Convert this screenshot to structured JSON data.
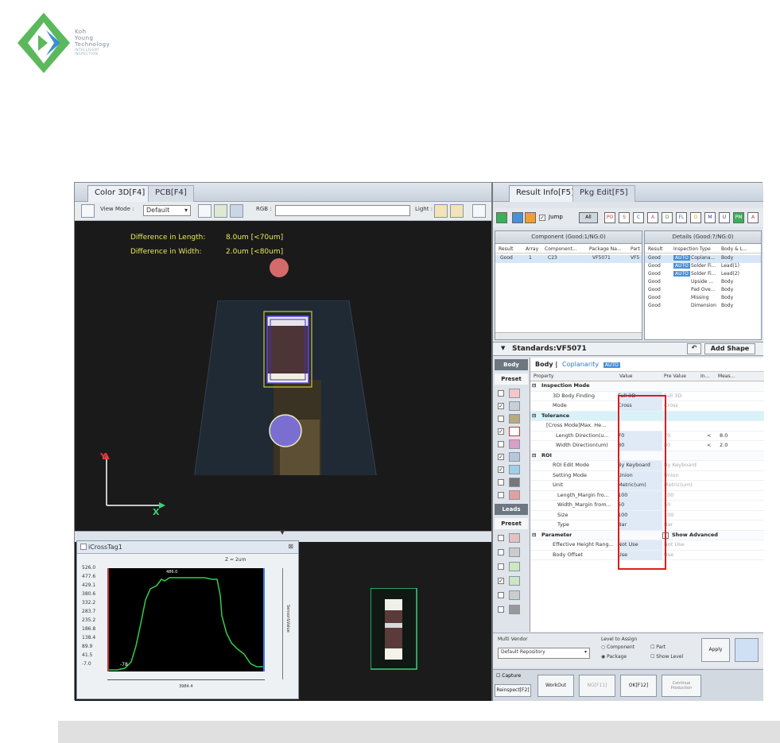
{
  "logo": {
    "line1": "Koh",
    "line2": "Young",
    "line3": "Technology",
    "tagline1": "INTELLIGENT",
    "tagline2": "INSPECTION"
  },
  "left_panel": {
    "tabs": [
      "Color 3D[F4]",
      "PCB[F4]"
    ],
    "toolbar": {
      "view_mode_label": "View Mode :",
      "view_mode_value": "Default",
      "rgb_label": "RGB :",
      "light_label": "Light :"
    },
    "measurements": {
      "length_label": "Difference in Length:",
      "length_value": "8.0um [<70um]",
      "width_label": "Difference in Width:",
      "width_value": "2.0um [<80um]"
    },
    "axes": {
      "x": "X",
      "y": "Y"
    },
    "graph_window": {
      "title": "iCrossTag1",
      "top_label": "Z = 2um",
      "peak_label": "486.0",
      "start_label": "-78",
      "x_label": "3984.4",
      "right_label": "Sensor&Value",
      "yticks": [
        "526.0",
        "477.6",
        "429.1",
        "380.6",
        "332.2",
        "283.7",
        "235.2",
        "186.8",
        "138.4",
        "89.9",
        "41.5",
        "-7.0"
      ]
    }
  },
  "right_panel": {
    "tabs": [
      "Result Info[F5]",
      "Pkg Edit[F5]"
    ],
    "filter": {
      "jump_label": "Jump",
      "all_label": "All",
      "chips": [
        "PO",
        "S",
        "C",
        "A",
        "D",
        "FL",
        "O",
        "M",
        "U",
        "PM",
        "A"
      ]
    },
    "component_table": {
      "title": "Component (Good:1/NG:0)",
      "columns": [
        "Result",
        "Array",
        "Component...",
        "Package Na...",
        "Part"
      ],
      "rows": [
        [
          "Good",
          "1",
          "C23",
          "VF5071",
          "VF5"
        ]
      ]
    },
    "details_table": {
      "title": "Details (Good:7/NG:0)",
      "columns": [
        "Result",
        "Inspection Type",
        "Body & L..."
      ],
      "rows": [
        [
          "Good",
          "AUTO",
          "Coplana...",
          "Body"
        ],
        [
          "Good",
          "AUTO",
          "Solder Fi...",
          "Lead(1)"
        ],
        [
          "Good",
          "AUTO",
          "Solder Fi...",
          "Lead(2)"
        ],
        [
          "Good",
          "",
          "Upside ...",
          "Body"
        ],
        [
          "Good",
          "",
          "Pad Ove...",
          "Body"
        ],
        [
          "Good",
          "",
          "Missing",
          "Body"
        ],
        [
          "Good",
          "",
          "Dimension",
          "Body"
        ]
      ]
    },
    "standards": {
      "label": "Standards:VF5071",
      "add_shape": "Add Shape"
    },
    "side": {
      "body_header": "Body",
      "preset1": "Preset",
      "leads_header": "Leads",
      "preset2": "Preset"
    },
    "properties": {
      "title": "Body |",
      "title_link": "Coplanarity",
      "title_badge": "AUTO",
      "columns": [
        "Property",
        "Value",
        "Pre Value",
        "In...",
        "Meas..."
      ],
      "rows": [
        {
          "name": "Inspection Mode",
          "value": "",
          "pre": "",
          "meas": "",
          "group": true
        },
        {
          "name": "3D Body Finding",
          "value": "Full 3D",
          "pre": "Full 3D",
          "meas": ""
        },
        {
          "name": "Mode",
          "value": "Cross",
          "pre": "Cross",
          "meas": ""
        },
        {
          "name": "Tolerance",
          "value": "",
          "pre": "",
          "meas": "",
          "group": true,
          "hl": true
        },
        {
          "name": "[Cross Mode]Max. He...",
          "value": "",
          "pre": "",
          "meas": ""
        },
        {
          "name": "Length Direction(u...",
          "value": "70",
          "pre": "70",
          "meas": "8.0"
        },
        {
          "name": "Width Direction(um)",
          "value": "80",
          "pre": "80",
          "meas": "2.0"
        },
        {
          "name": "ROI",
          "value": "",
          "pre": "",
          "meas": "",
          "group": true
        },
        {
          "name": "ROI Edit Mode",
          "value": "By Keyboard",
          "pre": "By Keyboard",
          "meas": ""
        },
        {
          "name": "Setting Mode",
          "value": "Union",
          "pre": "Union",
          "meas": ""
        },
        {
          "name": "Unit",
          "value": "Metric(um)",
          "pre": "Metric(um)",
          "meas": ""
        },
        {
          "name": "Length_Margin fro...",
          "value": "100",
          "pre": "100",
          "meas": ""
        },
        {
          "name": "Width_Margin from...",
          "value": "50",
          "pre": "50",
          "meas": ""
        },
        {
          "name": "Size",
          "value": "100",
          "pre": "100",
          "meas": ""
        },
        {
          "name": "Type",
          "value": "Bar",
          "pre": "Bar",
          "meas": ""
        },
        {
          "name": "Parameter",
          "value": "",
          "pre": "",
          "meas": "",
          "group": true
        },
        {
          "name": "Effective Height Rang...",
          "value": "Not Use",
          "pre": "Not Use",
          "meas": ""
        },
        {
          "name": "Body Offset",
          "value": "Use",
          "pre": "Use",
          "meas": ""
        }
      ],
      "show_advanced": "Show Advanced"
    },
    "settings": {
      "multi_vendor_label": "Multi Vendor",
      "multi_vendor_value": "Default Repository",
      "level_label": "Level to Assign",
      "component": "Component",
      "part": "Part",
      "package": "Package",
      "show_level": "Show Level",
      "apply": "Apply"
    },
    "buttons": {
      "capture": "Capture",
      "reinspect": "Reinspect[F2]",
      "workout": "WorkOut",
      "ng": "NG[F11]",
      "ok": "OK[F12]",
      "continue1": "Continue",
      "continue2": "Production"
    }
  }
}
